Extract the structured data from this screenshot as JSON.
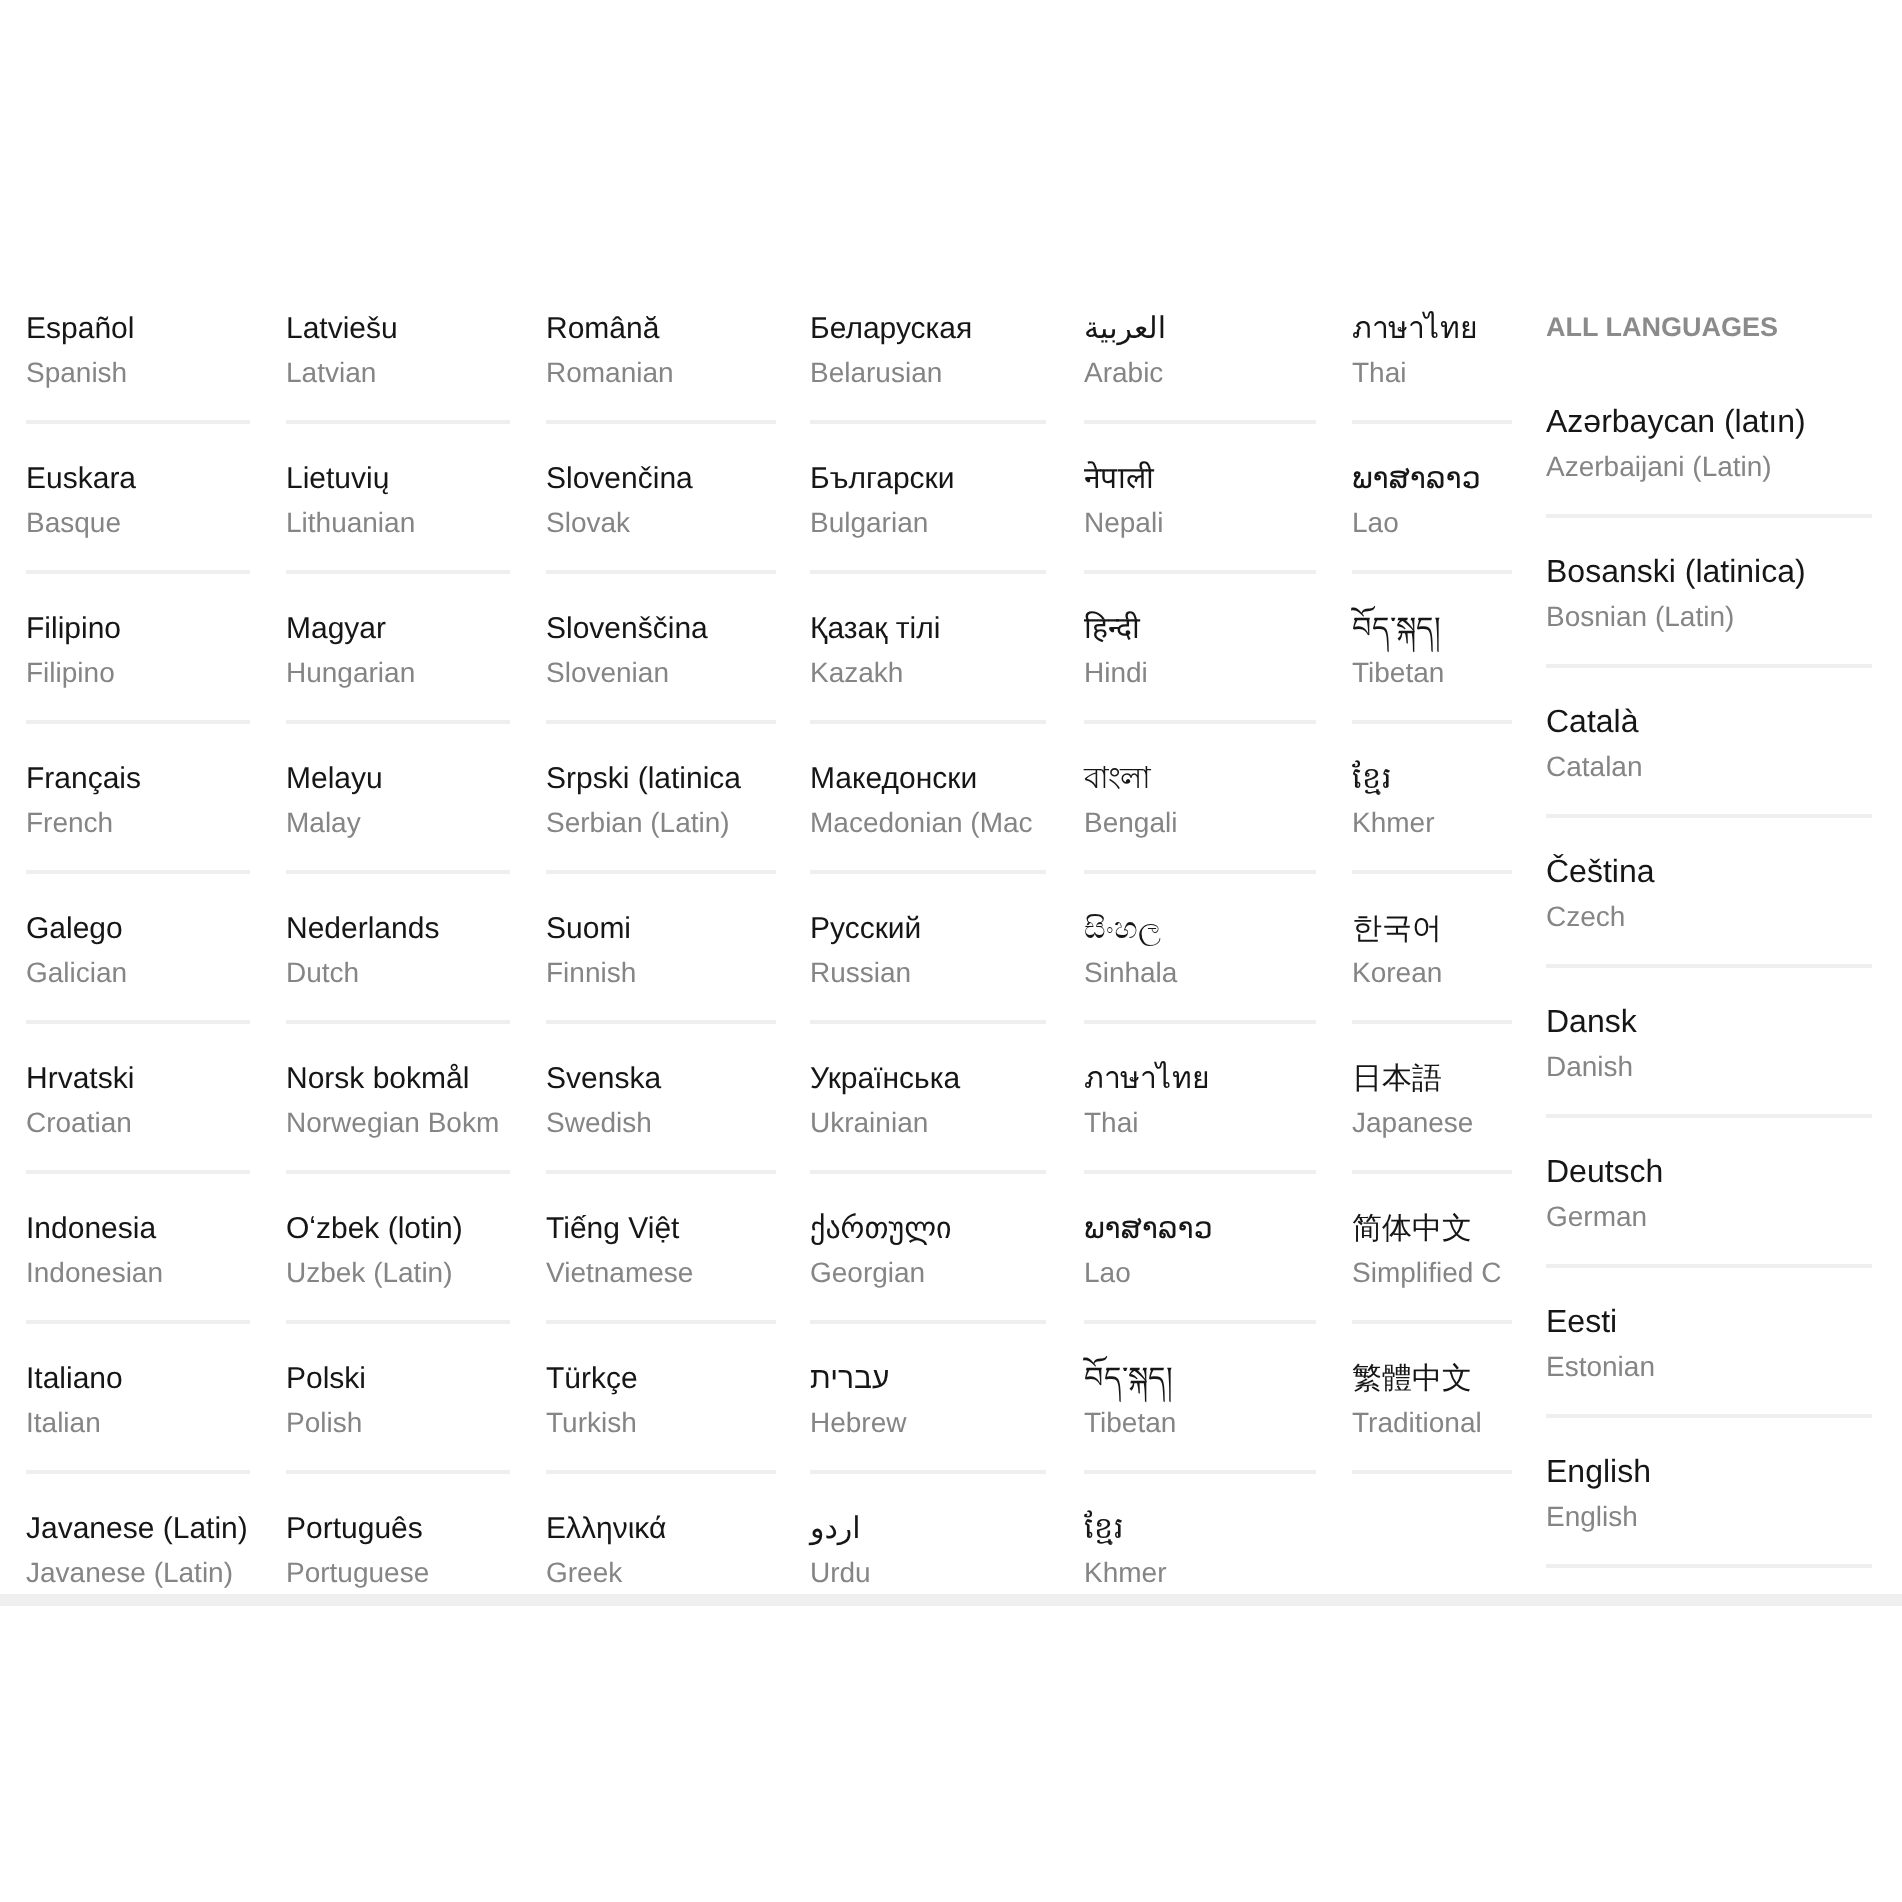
{
  "panels": [
    {
      "items": [
        {
          "name": "Español",
          "translation": "Spanish"
        },
        {
          "name": "Euskara",
          "translation": "Basque"
        },
        {
          "name": "Filipino",
          "translation": "Filipino"
        },
        {
          "name": "Français",
          "translation": "French"
        },
        {
          "name": "Galego",
          "translation": "Galician"
        },
        {
          "name": "Hrvatski",
          "translation": "Croatian"
        },
        {
          "name": "Indonesia",
          "translation": "Indonesian"
        },
        {
          "name": "Italiano",
          "translation": "Italian"
        },
        {
          "name": "Javanese (Latin)",
          "translation": "Javanese (Latin)"
        }
      ]
    },
    {
      "items": [
        {
          "name": "Latviešu",
          "translation": "Latvian"
        },
        {
          "name": "Lietuvių",
          "translation": "Lithuanian"
        },
        {
          "name": "Magyar",
          "translation": "Hungarian"
        },
        {
          "name": "Melayu",
          "translation": "Malay"
        },
        {
          "name": "Nederlands",
          "translation": "Dutch"
        },
        {
          "name": "Norsk bokmål",
          "translation": "Norwegian Bokm"
        },
        {
          "name": "Oʻzbek (lotin)",
          "translation": "Uzbek (Latin)"
        },
        {
          "name": "Polski",
          "translation": "Polish"
        },
        {
          "name": "Português",
          "translation": "Portuguese"
        }
      ]
    },
    {
      "items": [
        {
          "name": "Română",
          "translation": "Romanian"
        },
        {
          "name": "Slovenčina",
          "translation": "Slovak"
        },
        {
          "name": "Slovenščina",
          "translation": "Slovenian"
        },
        {
          "name": "Srpski (latinica",
          "translation": "Serbian (Latin)"
        },
        {
          "name": "Suomi",
          "translation": "Finnish"
        },
        {
          "name": "Svenska",
          "translation": "Swedish"
        },
        {
          "name": "Tiếng Việt",
          "translation": "Vietnamese"
        },
        {
          "name": "Türkçe",
          "translation": "Turkish"
        },
        {
          "name": "Ελληνικά",
          "translation": "Greek"
        }
      ]
    },
    {
      "items": [
        {
          "name": "Беларуская",
          "translation": "Belarusian"
        },
        {
          "name": "Български",
          "translation": "Bulgarian"
        },
        {
          "name": "Қазақ тілі",
          "translation": "Kazakh"
        },
        {
          "name": "Македонски",
          "translation": "Macedonian (Mac"
        },
        {
          "name": "Русский",
          "translation": "Russian"
        },
        {
          "name": "Українська",
          "translation": "Ukrainian"
        },
        {
          "name": "ქართული",
          "translation": "Georgian"
        },
        {
          "name": "עברית",
          "translation": "Hebrew"
        },
        {
          "name": "اردو",
          "translation": "Urdu"
        }
      ]
    },
    {
      "items": [
        {
          "name": "العربية",
          "translation": "Arabic"
        },
        {
          "name": "नेपाली",
          "translation": "Nepali"
        },
        {
          "name": "हिन्दी",
          "translation": "Hindi"
        },
        {
          "name": "বাংলা",
          "translation": "Bengali"
        },
        {
          "name": "සිංහල",
          "translation": "Sinhala"
        },
        {
          "name": "ภาษาไทย",
          "translation": "Thai"
        },
        {
          "name": "ພາສາລາວ",
          "translation": "Lao"
        },
        {
          "name": "བོད་སྐད།",
          "translation": "Tibetan"
        },
        {
          "name": "ខ្មែរ",
          "translation": "Khmer"
        }
      ]
    },
    {
      "items": [
        {
          "name": "ภาษาไทย",
          "translation": "Thai"
        },
        {
          "name": "ພາສາລາວ",
          "translation": "Lao"
        },
        {
          "name": "བོད་སྐད།",
          "translation": "Tibetan"
        },
        {
          "name": "ខ្មែរ",
          "translation": "Khmer"
        },
        {
          "name": "한국어",
          "translation": "Korean"
        },
        {
          "name": "日本語",
          "translation": "Japanese"
        },
        {
          "name": "简体中文",
          "translation": "Simplified C"
        },
        {
          "name": "繁體中文",
          "translation": "Traditional"
        }
      ]
    },
    {
      "heading": "ALL LANGUAGES",
      "items": [
        {
          "name": "Azərbaycan (latın)",
          "translation": "Azerbaijani (Latin)"
        },
        {
          "name": "Bosanski (latinica)",
          "translation": "Bosnian (Latin)"
        },
        {
          "name": "Català",
          "translation": "Catalan"
        },
        {
          "name": "Čeština",
          "translation": "Czech"
        },
        {
          "name": "Dansk",
          "translation": "Danish"
        },
        {
          "name": "Deutsch",
          "translation": "German"
        },
        {
          "name": "Eesti",
          "translation": "Estonian"
        },
        {
          "name": "English",
          "translation": "English"
        }
      ]
    }
  ]
}
